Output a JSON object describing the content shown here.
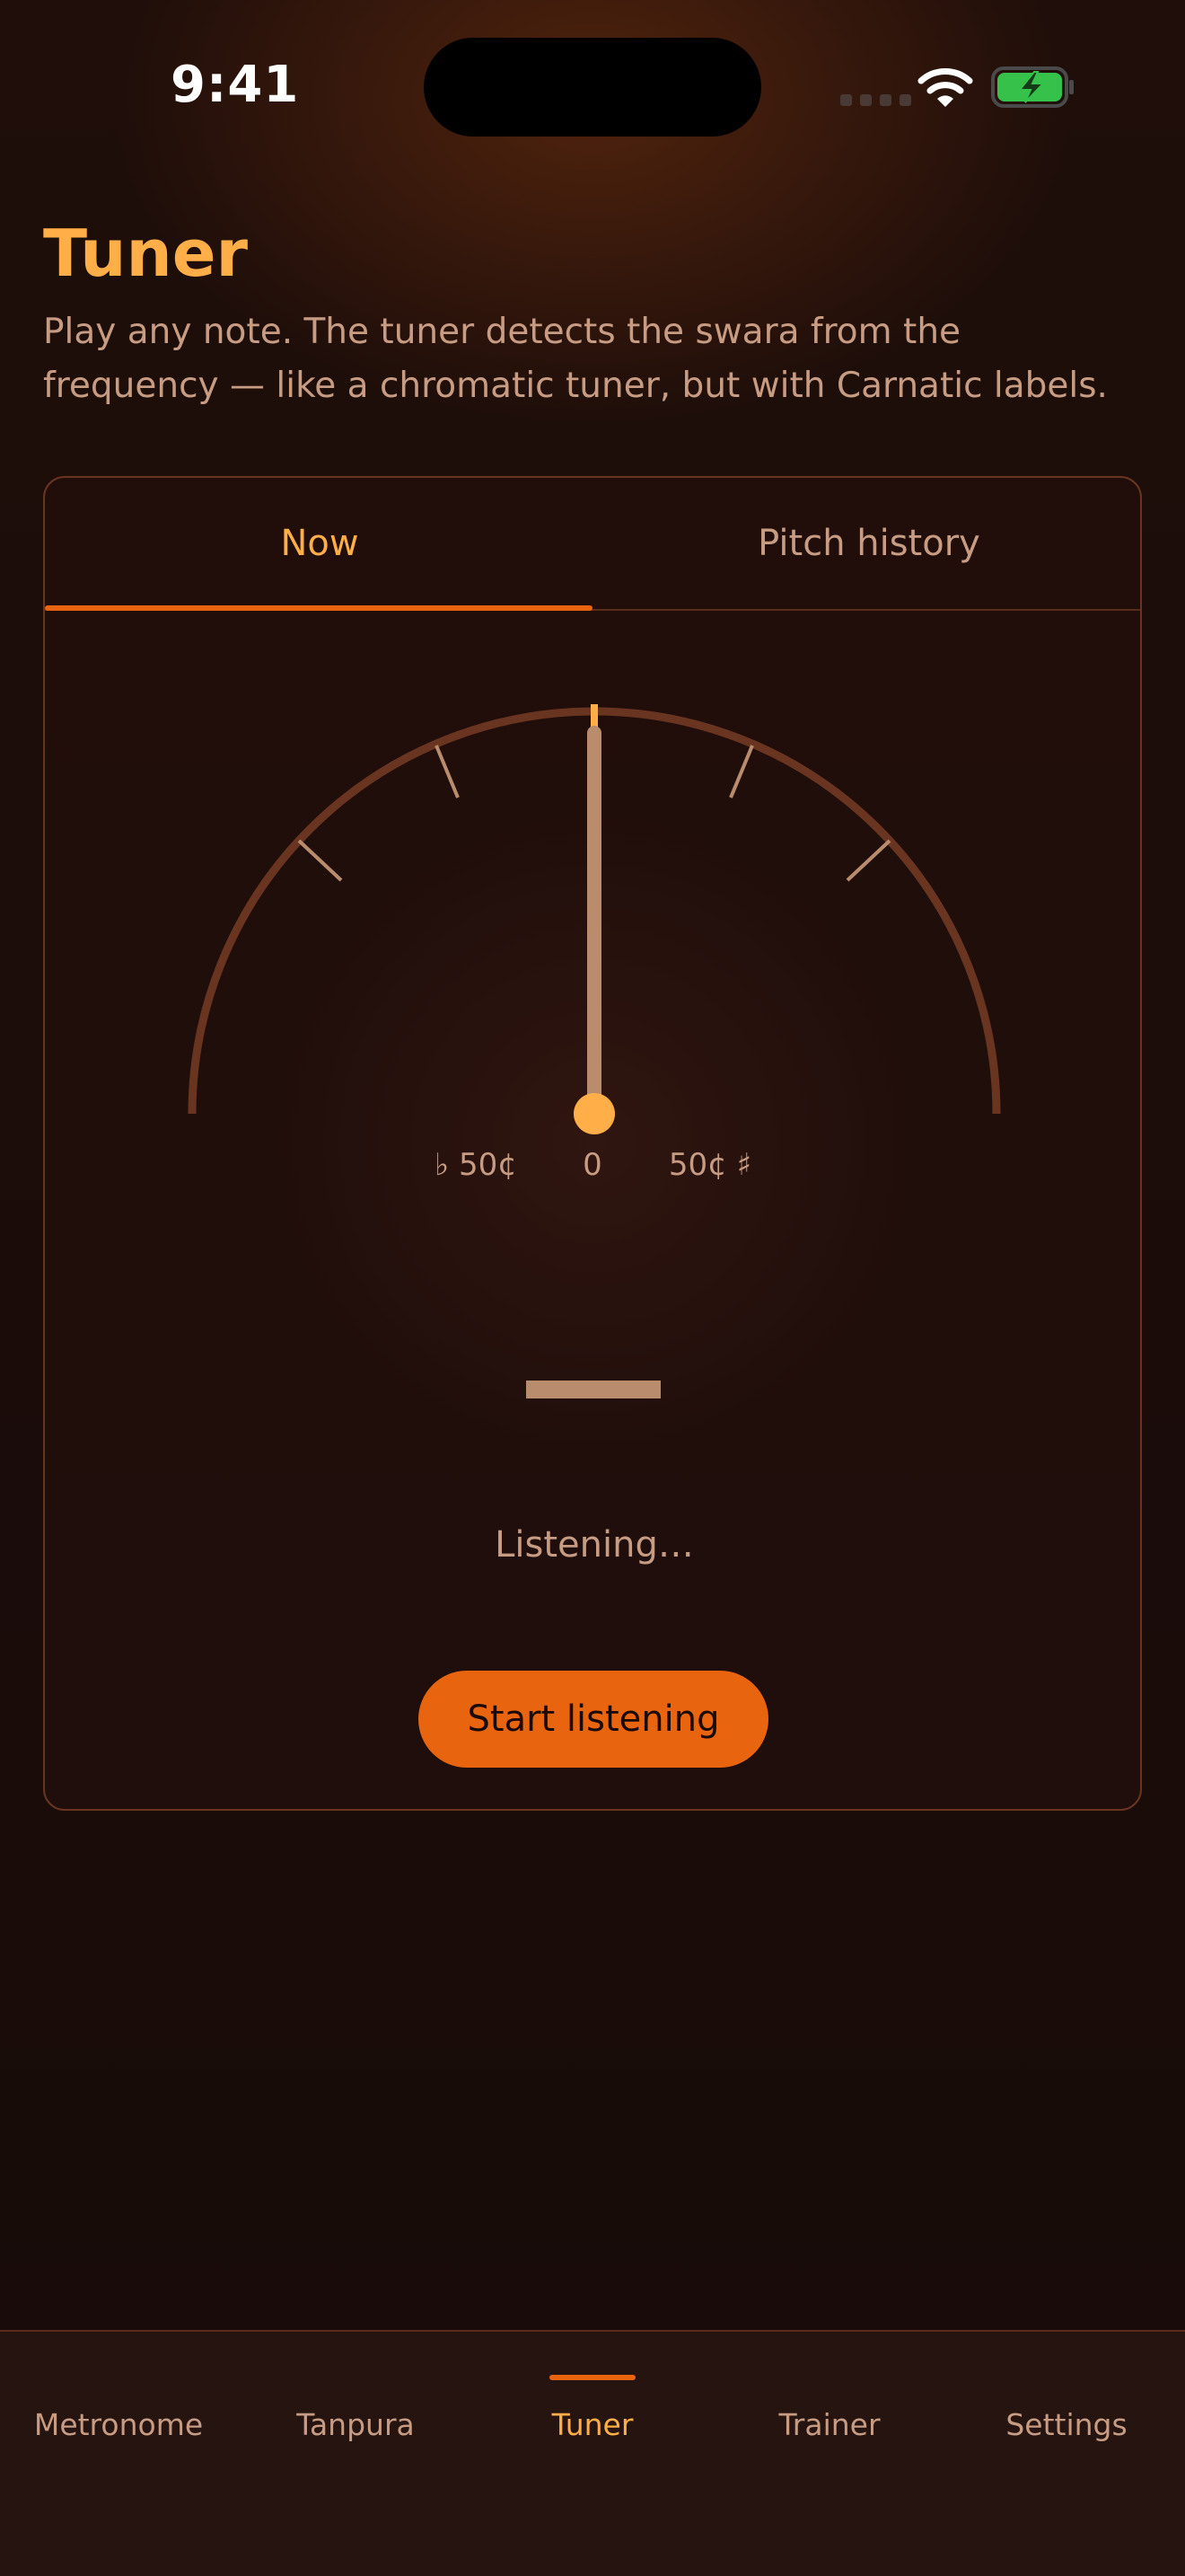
{
  "status_bar": {
    "time": "9:41"
  },
  "header": {
    "title": "Tuner",
    "subtitle": "Play any note. The tuner detects the swara from the frequency — like a chromatic tuner, but with Carnatic labels."
  },
  "tabs": [
    {
      "label": "Now",
      "active": true
    },
    {
      "label": "Pitch history",
      "active": false
    }
  ],
  "gauge": {
    "flat_label": "♭ 50¢",
    "center_label": "0",
    "sharp_label": "50¢ ♯",
    "cents": 0
  },
  "status": {
    "text": "Listening…"
  },
  "actions": {
    "start_label": "Start listening"
  },
  "nav": {
    "items": [
      {
        "label": "Metronome"
      },
      {
        "label": "Tanpura"
      },
      {
        "label": "Tuner"
      },
      {
        "label": "Trainer"
      },
      {
        "label": "Settings"
      }
    ],
    "active_index": 2
  },
  "colors": {
    "accent": "#ffae48",
    "primary": "#e8640f",
    "text_muted": "#c79c82",
    "background": "#1b0d0a",
    "battery": "#36c24a"
  }
}
